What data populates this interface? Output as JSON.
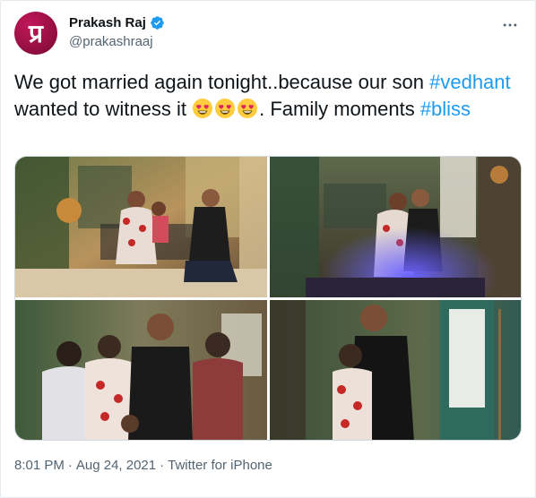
{
  "author": {
    "display_name": "Prakash Raj",
    "handle": "@prakashraaj",
    "avatar_glyph": "प्र",
    "verified": true
  },
  "tweet": {
    "text_part1": "We got married again tonight..because our son ",
    "hashtag1": "#vedhant",
    "text_part2": " wanted to witness it ",
    "emoji_name": "smiling-face-with-heart-eyes",
    "emoji_count": 3,
    "text_part3": ". Family moments ",
    "hashtag2": "#bliss"
  },
  "media": {
    "photos": [
      {
        "name": "photo-couple-on-swing"
      },
      {
        "name": "photo-couple-kiss"
      },
      {
        "name": "photo-family-group"
      },
      {
        "name": "photo-couple-embrace"
      }
    ]
  },
  "meta": {
    "time": "8:01 PM",
    "separator": "·",
    "date": "Aug 24, 2021",
    "source": "Twitter for iPhone"
  },
  "colors": {
    "link": "#1d9bf0",
    "secondary_text": "#536471",
    "verified_badge": "#1d9bf0"
  },
  "icons": {
    "verified": "verified-badge-icon",
    "more": "more-horizontal-icon"
  }
}
